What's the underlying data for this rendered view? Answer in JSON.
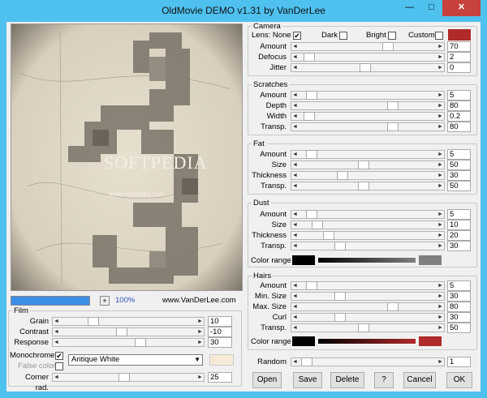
{
  "window": {
    "title": "OldMovie DEMO v1.31 by VanDerLee",
    "minimize_glyph": "—",
    "maximize_glyph": "□",
    "close_glyph": "✕"
  },
  "preview": {
    "watermark_title": "SOFTPEDIA",
    "watermark_url": "www.softpedia.com",
    "progress_percent": 100,
    "zoom_plus": "+",
    "zoom_label": "100%",
    "site": "www.VanDerLee.com"
  },
  "film": {
    "legend": "Film",
    "rows": [
      {
        "label": "Grain",
        "value": "10",
        "thumb": 0.22
      },
      {
        "label": "Contrast",
        "value": "-10",
        "thumb": 0.45
      },
      {
        "label": "Response",
        "value": "30",
        "thumb": 0.6
      }
    ],
    "monochrome_label": "Monochrome",
    "monochrome_checked": "✔",
    "false_color_label": "False color",
    "color_preset": "Antique White",
    "preset_swatch": "#f6ead7",
    "corner_label": "Corner rad.",
    "corner_value": "25",
    "corner_thumb": 0.47
  },
  "camera": {
    "legend": "Camera",
    "lens_label": "Lens: None",
    "lens_checked": "✔",
    "dark_label": "Dark",
    "bright_label": "Bright",
    "custom_label": "Custom",
    "custom_swatch": "#b02a2a",
    "rows": [
      {
        "label": "Amount",
        "value": "70",
        "thumb": 0.66
      },
      {
        "label": "Defocus",
        "value": "2",
        "thumb": 0.04
      },
      {
        "label": "Jitter",
        "value": "0",
        "thumb": 0.48
      }
    ]
  },
  "scratches": {
    "legend": "Scratches",
    "rows": [
      {
        "label": "Amount",
        "value": "5",
        "thumb": 0.06
      },
      {
        "label": "Depth",
        "value": "80",
        "thumb": 0.7
      },
      {
        "label": "Width",
        "value": "0.2",
        "thumb": 0.04
      },
      {
        "label": "Transp.",
        "value": "80",
        "thumb": 0.7
      }
    ]
  },
  "fat": {
    "legend": "Fat",
    "rows": [
      {
        "label": "Amount",
        "value": "5",
        "thumb": 0.06
      },
      {
        "label": "Size",
        "value": "50",
        "thumb": 0.47
      },
      {
        "label": "Thickness",
        "value": "30",
        "thumb": 0.3
      },
      {
        "label": "Transp.",
        "value": "50",
        "thumb": 0.47
      }
    ]
  },
  "dust": {
    "legend": "Dust",
    "rows": [
      {
        "label": "Amount",
        "value": "5",
        "thumb": 0.06
      },
      {
        "label": "Size",
        "value": "10",
        "thumb": 0.1
      },
      {
        "label": "Thickness",
        "value": "20",
        "thumb": 0.19
      },
      {
        "label": "Transp.",
        "value": "30",
        "thumb": 0.28
      }
    ],
    "color_range_label": "Color range",
    "color_start": "#000000",
    "color_end": "#7f7f7f"
  },
  "hairs": {
    "legend": "Hairs",
    "rows": [
      {
        "label": "Amount",
        "value": "5",
        "thumb": 0.06
      },
      {
        "label": "Min. Size",
        "value": "30",
        "thumb": 0.28
      },
      {
        "label": "Max. Size",
        "value": "80",
        "thumb": 0.7
      },
      {
        "label": "Curl",
        "value": "30",
        "thumb": 0.28
      },
      {
        "label": "Transp.",
        "value": "50",
        "thumb": 0.47
      }
    ],
    "color_range_label": "Color range",
    "color_start": "#000000",
    "color_end": "#b02a2a"
  },
  "random": {
    "label": "Random",
    "value": "1",
    "thumb": 0.02
  },
  "buttons": {
    "open": "Open",
    "save": "Save",
    "delete": "Delete",
    "help": "?",
    "cancel": "Cancel",
    "ok": "OK"
  },
  "glyphs": {
    "left": "◄",
    "right": "►",
    "dropdown": "▼"
  }
}
